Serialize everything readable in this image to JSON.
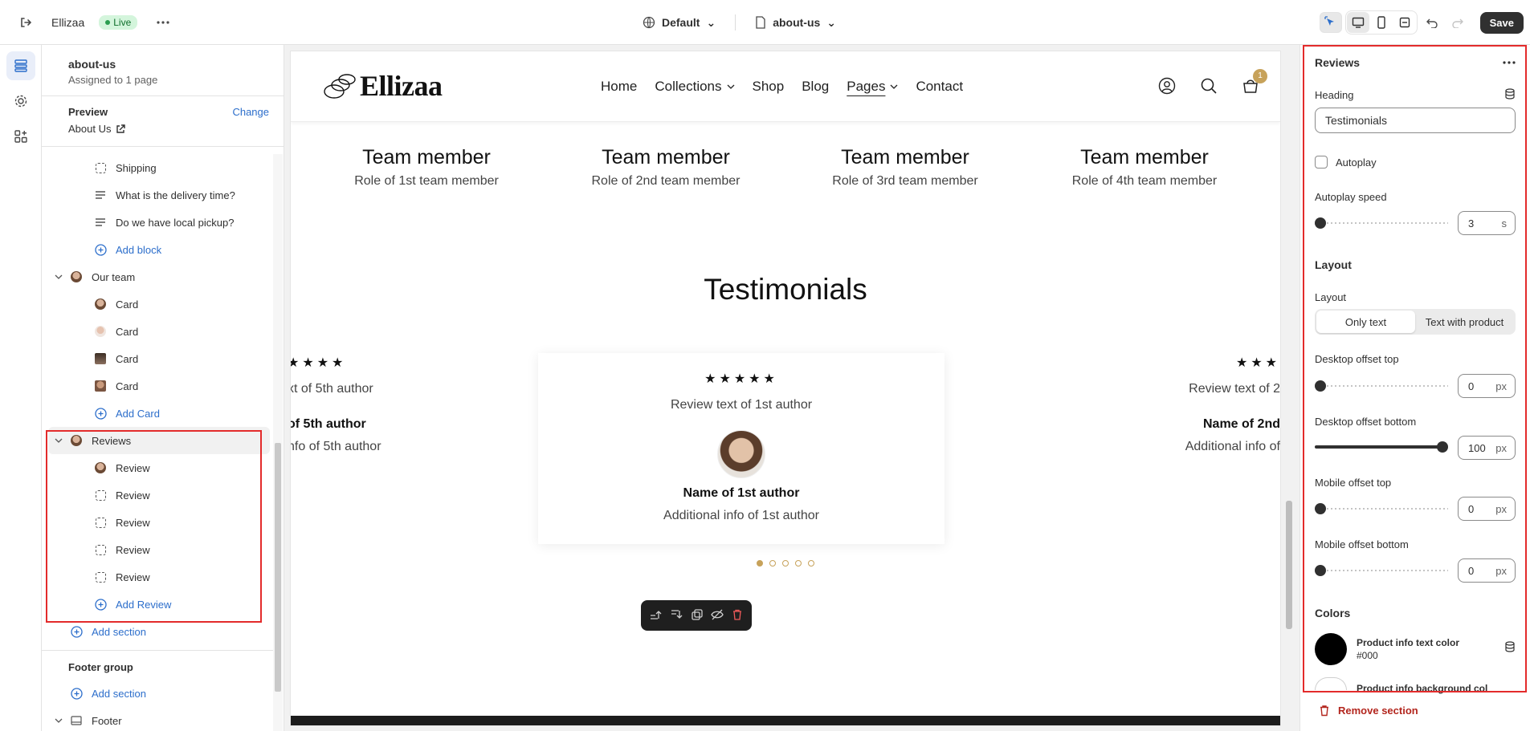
{
  "topbar": {
    "store_name": "Ellizaa",
    "live_badge": "Live",
    "theme_selector": "Default",
    "page_selector": "about-us",
    "save_label": "Save"
  },
  "leftpanel": {
    "template_name": "about-us",
    "assigned": "Assigned to 1 page",
    "preview_label": "Preview",
    "change_label": "Change",
    "preview_page": "About Us",
    "tree": {
      "shipping": "Shipping",
      "faq1": "What is the delivery time?",
      "faq2": "Do we have local pickup?",
      "add_block": "Add block",
      "our_team": "Our team",
      "cards": [
        "Card",
        "Card",
        "Card",
        "Card"
      ],
      "add_card": "Add Card",
      "reviews": "Reviews",
      "review_items": [
        "Review",
        "Review",
        "Review",
        "Review",
        "Review"
      ],
      "add_review": "Add Review",
      "add_section": "Add section",
      "footer_group": "Footer group",
      "add_section_2": "Add section",
      "footer": "Footer"
    }
  },
  "preview": {
    "logo": "Ellizaa",
    "nav": [
      "Home",
      "Collections",
      "Shop",
      "Blog",
      "Pages",
      "Contact"
    ],
    "cart_count": "1",
    "team": [
      {
        "name": "Team member",
        "role": "Role of 1st team member"
      },
      {
        "name": "Team member",
        "role": "Role of 2nd team member"
      },
      {
        "name": "Team member",
        "role": "Role of 3rd team member"
      },
      {
        "name": "Team member",
        "role": "Role of 4th team member"
      }
    ],
    "testimonials_heading": "Testimonials",
    "stars": "★★★★★",
    "left_review": {
      "stars": "★★★★",
      "text": "xt of 5th author",
      "name": "of 5th author",
      "info": "nfo of 5th author"
    },
    "center_review": {
      "text": "Review text of 1st author",
      "name": "Name of 1st author",
      "info": "Additional info of 1st author"
    },
    "right_review": {
      "stars": "★★★",
      "text": "Review text of 2",
      "name": "Name of 2nd",
      "info": "Additional info of"
    }
  },
  "rightpanel": {
    "title": "Reviews",
    "heading_label": "Heading",
    "heading_value": "Testimonials",
    "autoplay_label": "Autoplay",
    "autoplay_speed_label": "Autoplay speed",
    "autoplay_speed_value": "3",
    "autoplay_speed_unit": "s",
    "layout_section": "Layout",
    "layout_label": "Layout",
    "layout_options": [
      "Only text",
      "Text with product"
    ],
    "desktop_top_label": "Desktop offset top",
    "desktop_top_value": "0",
    "desktop_bottom_label": "Desktop offset bottom",
    "desktop_bottom_value": "100",
    "mobile_top_label": "Mobile offset top",
    "mobile_top_value": "0",
    "mobile_bottom_label": "Mobile offset bottom",
    "mobile_bottom_value": "0",
    "unit_px": "px",
    "colors_section": "Colors",
    "text_color_label": "Product info text color",
    "text_color_value": "#000",
    "bg_color_label": "Product info background col",
    "remove_section": "Remove section"
  },
  "colors": {
    "accent_gold": "#c7a25a",
    "highlight_red": "#e32b2b",
    "link_blue": "#2c6ecb"
  }
}
